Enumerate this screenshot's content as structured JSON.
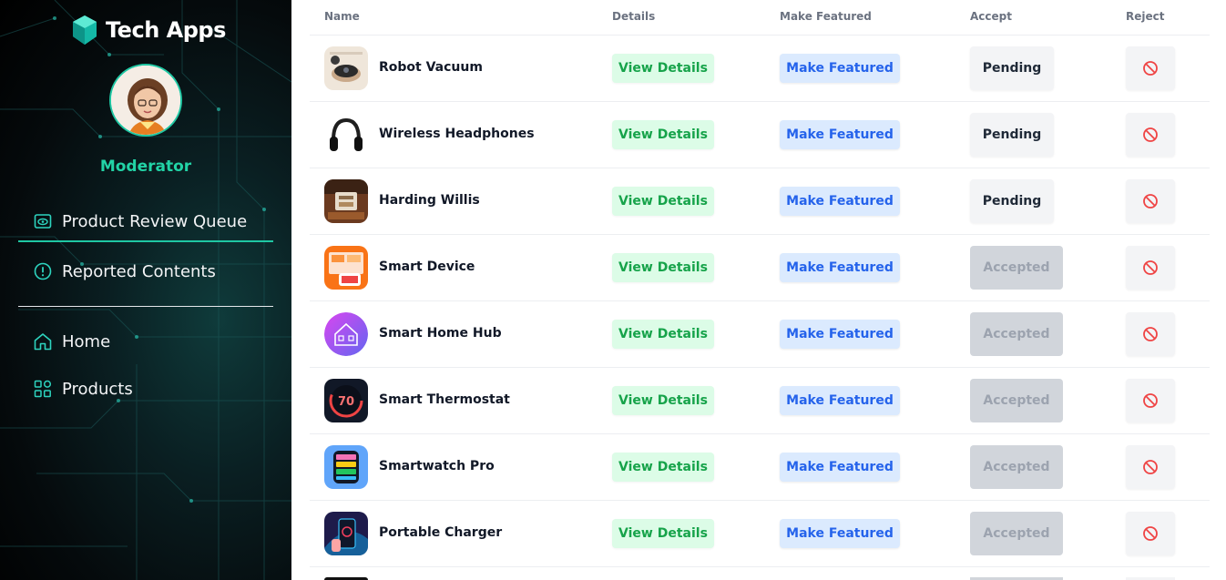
{
  "app": {
    "title": "Tech Apps"
  },
  "user": {
    "role": "Moderator"
  },
  "nav": {
    "review_queue": "Product Review Queue",
    "reported": "Reported Contents",
    "home": "Home",
    "products": "Products"
  },
  "table": {
    "headers": {
      "name": "Name",
      "details": "Details",
      "featured": "Make Featured",
      "accept": "Accept",
      "reject": "Reject"
    },
    "rows": [
      {
        "name": "Robot Vacuum",
        "details": "View Details",
        "featured": "Make Featured",
        "status": "Pending"
      },
      {
        "name": "Wireless Headphones",
        "details": "View Details",
        "featured": "Make Featured",
        "status": "Pending"
      },
      {
        "name": "Harding Willis",
        "details": "View Details",
        "featured": "Make Featured",
        "status": "Pending"
      },
      {
        "name": "Smart Device",
        "details": "View Details",
        "featured": "Make Featured",
        "status": "Accepted"
      },
      {
        "name": "Smart Home Hub",
        "details": "View Details",
        "featured": "Make Featured",
        "status": "Accepted"
      },
      {
        "name": "Smart Thermostat",
        "details": "View Details",
        "featured": "Make Featured",
        "status": "Accepted",
        "thumb_reading": "70"
      },
      {
        "name": "Smartwatch Pro",
        "details": "View Details",
        "featured": "Make Featured",
        "status": "Accepted"
      },
      {
        "name": "Portable Charger",
        "details": "View Details",
        "featured": "Make Featured",
        "status": "Accepted"
      }
    ]
  },
  "colors": {
    "accent": "#1fc7a3",
    "view_bg": "#dcfce7",
    "view_text": "#16a34a",
    "featured_bg": "#dbeafe",
    "featured_text": "#2563eb",
    "reject_icon": "#ef4444"
  }
}
